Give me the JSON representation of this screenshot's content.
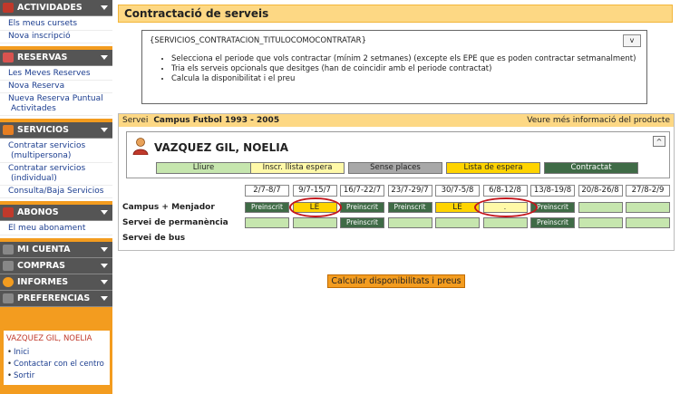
{
  "sidebar": {
    "sections": [
      {
        "title": "ACTIVIDADES",
        "icon": "calendar-icon",
        "items": [
          "Els meus cursets",
          "Nova inscripció"
        ]
      },
      {
        "title": "RESERVAS",
        "icon": "ticket-icon",
        "items": [
          "Les Meves Reserves",
          "Nova Reserva",
          "Nueva Reserva Puntual Activitades"
        ]
      },
      {
        "title": "SERVICIOS",
        "icon": "services-icon",
        "items": [
          "Contratar servicios (multipersona)",
          "Contratar servicios (individual)",
          "Consulta/Baja Servicios"
        ]
      },
      {
        "title": "ABONOS",
        "icon": "card-icon",
        "items": [
          "El meu abonament"
        ]
      },
      {
        "title": "MI CUENTA",
        "icon": "user-icon",
        "items": []
      },
      {
        "title": "COMPRAS",
        "icon": "cart-icon",
        "items": []
      },
      {
        "title": "INFORMES",
        "icon": "chart-icon",
        "items": []
      },
      {
        "title": "PREFERENCIAS",
        "icon": "prefs-icon",
        "items": []
      }
    ],
    "user": {
      "name": "VAZQUEZ GIL, NOELIA",
      "links": [
        "Inici",
        "Contactar con el centro",
        "Sortir"
      ]
    }
  },
  "main": {
    "title": "Contractació de serveis",
    "info": {
      "title": "{SERVICIOS_CONTRATACION_TITULOCOMOCONTRATAR}",
      "toggle": "v",
      "bullets": [
        "Selecciona el periode que vols contractar (mínim 2 setmanes) (excepte els EPE que es poden contractar setmanalment)",
        "Tria els serveis opcionals que desitges (han de coincidir amb el periode contractat)",
        "Calcula la disponibilitat i el preu"
      ]
    },
    "service": {
      "label": "Servei",
      "name": "Campus Futbol 1993 - 2005",
      "more_link": "Veure més informació del producte",
      "person": "VAZQUEZ GIL, NOELIA",
      "collapse": "^",
      "legend": [
        {
          "label": "Lliure",
          "color": "#c6e6ae"
        },
        {
          "label": "Inscr. llista espera",
          "color": "#fff9a8"
        },
        {
          "label": "Sense places",
          "color": "#a8a8a8"
        },
        {
          "label": "Lista de espera",
          "color": "#ffd400"
        },
        {
          "label": "Contractat",
          "color": "#3f6b46"
        }
      ],
      "weeks": [
        "2/7-8/7",
        "9/7-15/7",
        "16/7-22/7",
        "23/7-29/7",
        "30/7-5/8",
        "6/8-12/8",
        "13/8-19/8",
        "20/8-26/8",
        "27/8-2/9"
      ],
      "rows": [
        {
          "label": "Campus + Menjador",
          "cells": [
            "Preinscrit",
            "LE",
            "Preinscrit",
            "Preinscrit",
            "LE",
            ".",
            "Preinscrit",
            "",
            ""
          ]
        },
        {
          "label": "Servei de permanència",
          "cells": [
            "",
            "",
            "Preinscrit",
            "",
            "",
            "",
            "Preinscrit",
            "",
            ""
          ]
        },
        {
          "label": "Servei de bus",
          "cells": []
        }
      ]
    },
    "calc_button": "Calcular disponibilitats i preus"
  }
}
